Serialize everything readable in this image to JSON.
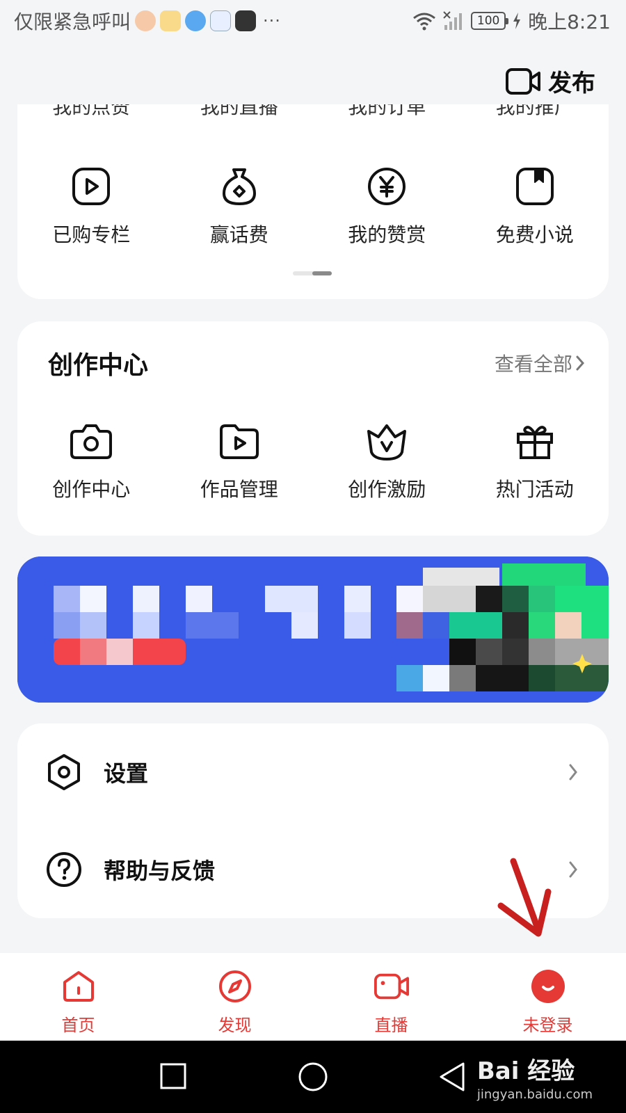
{
  "status_bar": {
    "left_text": "仅限紧急呼叫",
    "more": "···",
    "battery": "100",
    "time": "晚上8:21"
  },
  "header": {
    "publish_label": "发布"
  },
  "services_top": {
    "cut_labels": [
      "我的点赞",
      "我的直播",
      "我的订单",
      "我的推广"
    ],
    "items": [
      {
        "label": "已购专栏",
        "icon": "play-square-icon"
      },
      {
        "label": "赢话费",
        "icon": "money-bag-icon"
      },
      {
        "label": "我的赞赏",
        "icon": "yuan-coin-icon"
      },
      {
        "label": "免费小说",
        "icon": "book-icon"
      }
    ]
  },
  "creation_center": {
    "title": "创作中心",
    "view_all": "查看全部",
    "items": [
      {
        "label": "创作中心",
        "icon": "camera-icon"
      },
      {
        "label": "作品管理",
        "icon": "folder-play-icon"
      },
      {
        "label": "创作激励",
        "icon": "crown-v-icon"
      },
      {
        "label": "热门活动",
        "icon": "gift-icon"
      }
    ]
  },
  "menu": {
    "items": [
      {
        "label": "设置",
        "icon": "settings-icon"
      },
      {
        "label": "帮助与反馈",
        "icon": "help-icon"
      }
    ]
  },
  "bottom_nav": {
    "items": [
      {
        "label": "首页",
        "icon": "home-icon"
      },
      {
        "label": "发现",
        "icon": "compass-icon"
      },
      {
        "label": "直播",
        "icon": "live-icon"
      },
      {
        "label": "未登录",
        "icon": "avatar-icon"
      }
    ]
  },
  "watermark": {
    "main": "Bai 经验",
    "sub": "jingyan.baidu.com"
  },
  "colors": {
    "accent_red": "#e53935",
    "banner_blue": "#3a5ae8",
    "annotation_arrow": "#c8201e"
  }
}
